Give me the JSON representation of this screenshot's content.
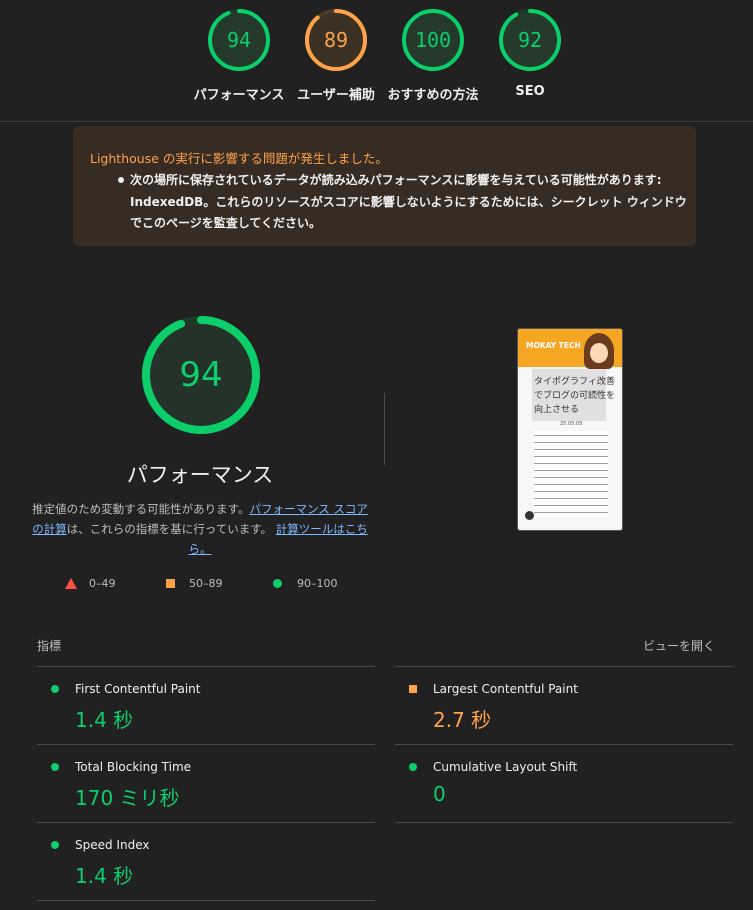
{
  "scores": [
    {
      "value": "94",
      "label": "パフォーマンス",
      "color": "#0cce6b",
      "fraction": 0.94
    },
    {
      "value": "89",
      "label": "ユーザー補助",
      "color": "#ffa24a",
      "fraction": 0.89
    },
    {
      "value": "100",
      "label": "おすすめの方法",
      "color": "#0cce6b",
      "fraction": 1.0
    },
    {
      "value": "92",
      "label": "SEO",
      "color": "#0cce6b",
      "fraction": 0.92
    }
  ],
  "warning": {
    "title": "Lighthouse の実行に影響する問題が発生しました。",
    "lines": [
      "次の場所に保存されているデータが読み込みパフォーマンスに影響を与えている可能性があります:",
      "IndexedDB。これらのリソースがスコアに影響しないようにするためには、シークレット ウィンドウ",
      "でこのページを監査してください。"
    ]
  },
  "performance": {
    "score": "94",
    "fraction": 0.94,
    "title": "パフォーマンス",
    "desc_part1": "推定値のため変動する可能性があります。",
    "desc_link1": "パフォーマンス スコアの計算",
    "desc_part2": "は、これらの指標を基に行っています。",
    "desc_link2": "計算ツールはこちら。"
  },
  "legend": [
    {
      "range": "0–49",
      "shape": "triangle",
      "color": "#ff4e42"
    },
    {
      "range": "50–89",
      "shape": "square",
      "color": "#ffa24a"
    },
    {
      "range": "90–100",
      "shape": "circle",
      "color": "#0cce6b"
    }
  ],
  "thumbnail": {
    "site_name": "MOKAY TECH",
    "article_title_1": "タイポグラフィ改善",
    "article_title_2": "でブログの可読性を",
    "article_title_3": "向上させる",
    "date": "25.05.05"
  },
  "metrics_section": {
    "title": "指標",
    "expand_label": "ビューを開く"
  },
  "metrics": [
    {
      "label": "First Contentful Paint",
      "value": "1.4 秒",
      "status": "good"
    },
    {
      "label": "Largest Contentful Paint",
      "value": "2.7 秒",
      "status": "average"
    },
    {
      "label": "Total Blocking Time",
      "value": "170 ミリ秒",
      "status": "good"
    },
    {
      "label": "Cumulative Layout Shift",
      "value": "0",
      "status": "good"
    },
    {
      "label": "Speed Index",
      "value": "1.4 秒",
      "status": "good"
    }
  ]
}
